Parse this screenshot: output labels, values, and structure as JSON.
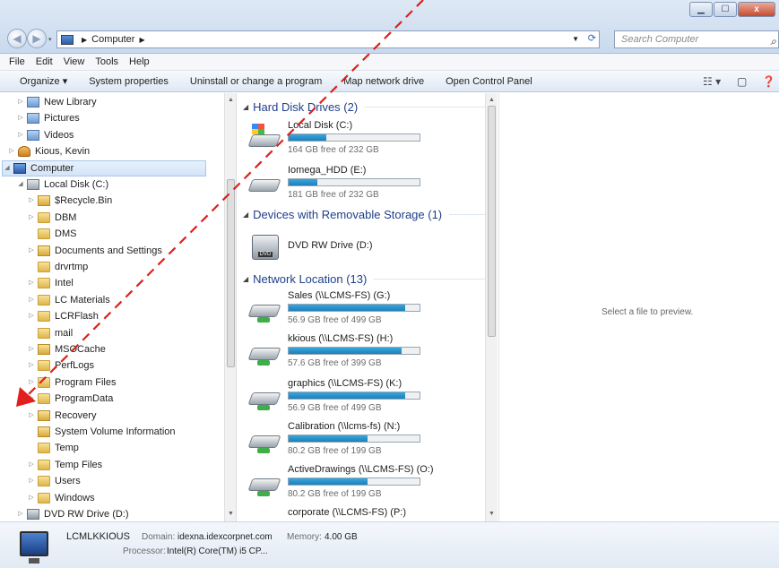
{
  "window": {
    "minimize_icon": "minimize-icon",
    "maximize_icon": "maximize-icon",
    "close_label": "x"
  },
  "address_bar": {
    "path": [
      "Computer"
    ],
    "search_placeholder": "Search Computer"
  },
  "menu": [
    "File",
    "Edit",
    "View",
    "Tools",
    "Help"
  ],
  "command_bar": {
    "organize": "Organize ▾",
    "items": [
      "System properties",
      "Uninstall or change a program",
      "Map network drive",
      "Open Control Panel"
    ]
  },
  "nav_tree": [
    {
      "label": "New Library",
      "icon": "library"
    },
    {
      "label": "Pictures",
      "icon": "library"
    },
    {
      "label": "Videos",
      "icon": "library"
    },
    {
      "label": "Kious, Kevin",
      "icon": "user"
    },
    {
      "label": "Computer",
      "icon": "computer"
    },
    {
      "label": "Local Disk (C:)",
      "icon": "drive"
    },
    {
      "label": "$Recycle.Bin",
      "icon": "folder-lock"
    },
    {
      "label": "DBM",
      "icon": "folder"
    },
    {
      "label": "DMS",
      "icon": "folder"
    },
    {
      "label": "Documents and Settings",
      "icon": "folder-lock"
    },
    {
      "label": "drvrtmp",
      "icon": "folder"
    },
    {
      "label": "Intel",
      "icon": "folder"
    },
    {
      "label": "LC Materials",
      "icon": "folder"
    },
    {
      "label": "LCRFlash",
      "icon": "folder"
    },
    {
      "label": "mail",
      "icon": "folder"
    },
    {
      "label": "MSOCache",
      "icon": "folder-lock"
    },
    {
      "label": "PerfLogs",
      "icon": "folder"
    },
    {
      "label": "Program Files",
      "icon": "folder"
    },
    {
      "label": "ProgramData",
      "icon": "folder"
    },
    {
      "label": "Recovery",
      "icon": "folder-lock"
    },
    {
      "label": "System Volume Information",
      "icon": "folder-lock"
    },
    {
      "label": "Temp",
      "icon": "folder"
    },
    {
      "label": "Temp Files",
      "icon": "folder"
    },
    {
      "label": "Users",
      "icon": "folder"
    },
    {
      "label": "Windows",
      "icon": "folder"
    },
    {
      "label": "DVD RW Drive (D:)",
      "icon": "dvd"
    }
  ],
  "groups": [
    {
      "title": "Hard Disk Drives (2)",
      "drives": [
        {
          "name": "Local Disk (C:)",
          "free": "164 GB free of 232 GB",
          "used_fraction": 0.29,
          "icon": "windows-drive"
        },
        {
          "name": "Iomega_HDD (E:)",
          "free": "181 GB free of 232 GB",
          "used_fraction": 0.22,
          "icon": "hdd"
        }
      ]
    },
    {
      "title": "Devices with Removable Storage (1)",
      "drives": [
        {
          "name": "DVD RW Drive (D:)",
          "icon": "dvd"
        }
      ]
    },
    {
      "title": "Network Location (13)",
      "drives": [
        {
          "name": "Sales (\\\\LCMS-FS) (G:)",
          "free": "56.9 GB free of 499 GB",
          "used_fraction": 0.89,
          "icon": "network"
        },
        {
          "name": "kkious (\\\\LCMS-FS) (H:)",
          "free": "57.6 GB free of 399 GB",
          "used_fraction": 0.86,
          "icon": "network"
        },
        {
          "name": "graphics (\\\\LCMS-FS) (K:)",
          "free": "56.9 GB free of 499 GB",
          "used_fraction": 0.89,
          "icon": "network"
        },
        {
          "name": "Calibration (\\\\lcms-fs) (N:)",
          "free": "80.2 GB free of 199 GB",
          "used_fraction": 0.6,
          "icon": "network"
        },
        {
          "name": "ActiveDrawings (\\\\LCMS-FS) (O:)",
          "free": "80.2 GB free of 199 GB",
          "used_fraction": 0.6,
          "icon": "network"
        },
        {
          "name": "corporate (\\\\LCMS-FS) (P:)",
          "icon": "network"
        }
      ]
    }
  ],
  "preview": {
    "text": "Select a file to preview."
  },
  "details": {
    "name": "LCMLKKIOUS",
    "domain_label": "Domain:",
    "domain_value": "idexna.idexcorpnet.com",
    "memory_label": "Memory:",
    "memory_value": "4.00 GB",
    "processor_label": "Processor:",
    "processor_value": "Intel(R) Core(TM) i5 CP..."
  },
  "colors": {
    "annotation": "#e0201c",
    "bar_fill": "#2790cc",
    "group_title": "#1e3f8a"
  }
}
